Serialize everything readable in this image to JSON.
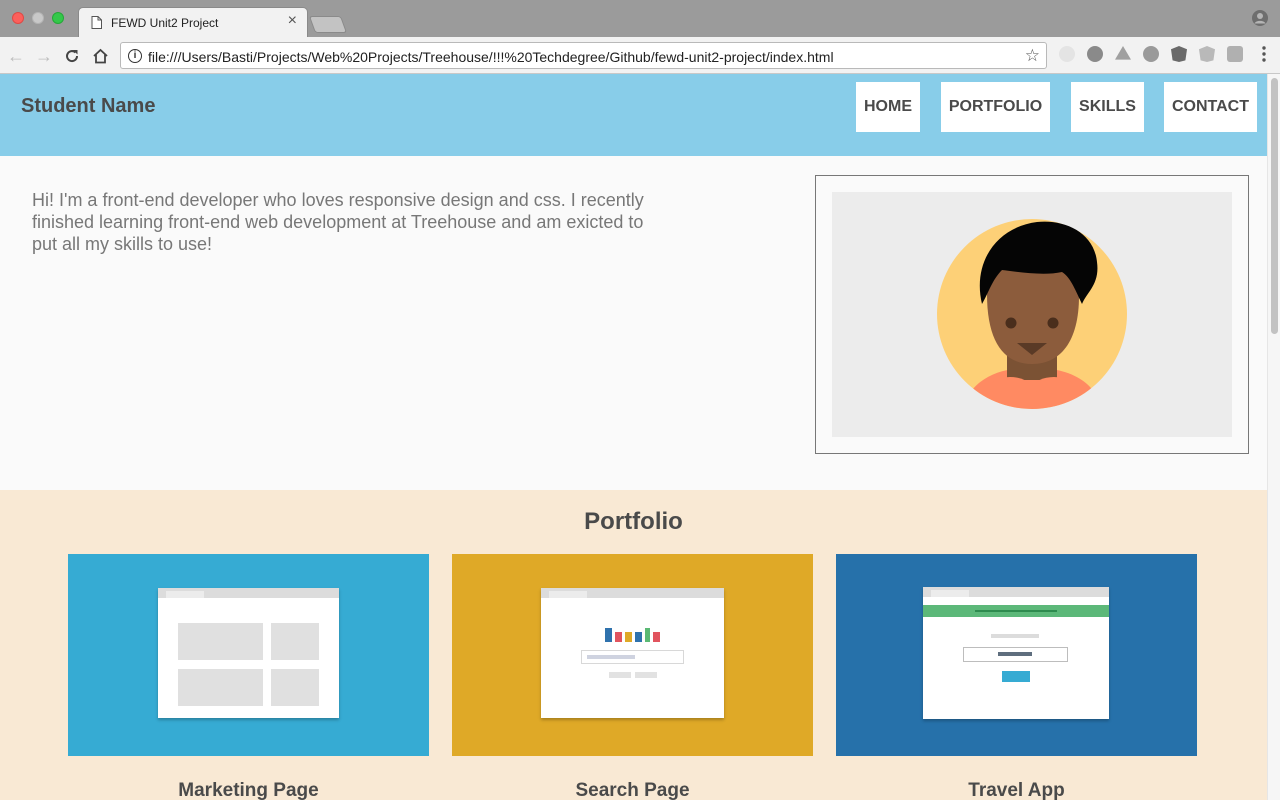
{
  "browser": {
    "tab_title": "FEWD Unit2 Project",
    "url": "file:///Users/Basti/Projects/Web%20Projects/Treehouse/!!!%20Techdegree/Github/fewd-unit2-project/index.html"
  },
  "site": {
    "name": "Student Name",
    "nav": [
      {
        "label": "HOME"
      },
      {
        "label": "PORTFOLIO"
      },
      {
        "label": "SKILLS"
      },
      {
        "label": "CONTACT"
      }
    ],
    "intro": "Hi! I'm a front-end developer who loves responsive design and css. I recently finished learning front-end web development at Treehouse and am exicted to put all my skills to use!"
  },
  "portfolio": {
    "title": "Portfolio",
    "items": [
      {
        "title": "Marketing Page",
        "color": "#36abd3"
      },
      {
        "title": "Search Page",
        "color": "#dfa927"
      },
      {
        "title": "Travel App",
        "color": "#2671aa"
      }
    ]
  },
  "colors": {
    "header_bg": "#88cde9",
    "portfolio_bg": "#f9e9d4",
    "text_dark": "#4a4a4a",
    "text_body": "#777777"
  },
  "icons": [
    "document-icon",
    "close-icon",
    "profile-icon",
    "back-icon",
    "forward-icon",
    "reload-icon",
    "home-icon",
    "info-icon",
    "star-icon",
    "menu-icon"
  ]
}
